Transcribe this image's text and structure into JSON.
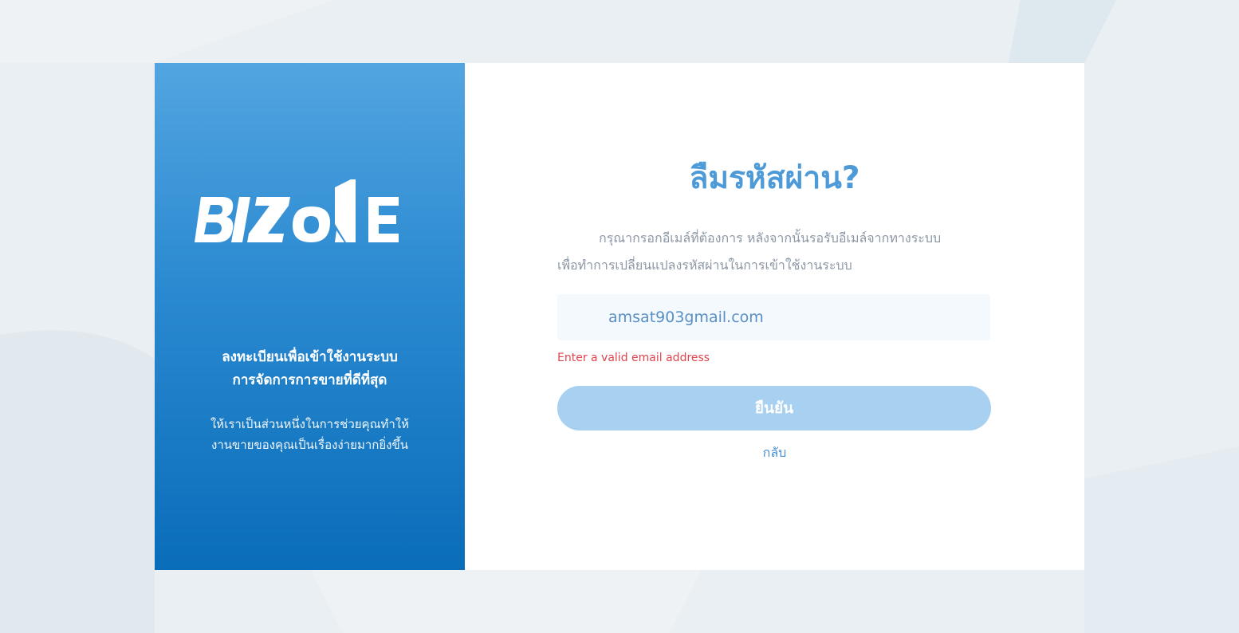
{
  "brand": {
    "logo_text": "BIZONE"
  },
  "left_panel": {
    "headline_line1": "ลงทะเบียนเพื่อเข้าใช้งานระบบ",
    "headline_line2": "การจัดการการขายที่ดีที่สุด",
    "sub_line1": "ให้เราเป็นส่วนหนึ่งในการช่วยคุณทำให้",
    "sub_line2": "งานขายของคุณเป็นเรื่องง่ายมากยิ่งขึ้น"
  },
  "form": {
    "title": "ลืมรหัสผ่าน?",
    "description_line1": "กรุณากรอกอีเมล์ที่ต้องการ หลังจากนั้นรอรับอีเมล์จากทางระบบ",
    "description_line2": "เพื่อทำการเปลี่ยนแปลงรหัสผ่านในการเข้าใช้งานระบบ",
    "email_value": "amsat903gmail.com",
    "error_message": "Enter a valid email address",
    "confirm_label": "ยืนยัน",
    "back_label": "กลับ"
  },
  "colors": {
    "accent": "#4d9ad8",
    "button_disabled": "#a8d0f0",
    "error": "#e0444f",
    "panel_top": "#52a5e0",
    "panel_bottom": "#0a6dba"
  }
}
